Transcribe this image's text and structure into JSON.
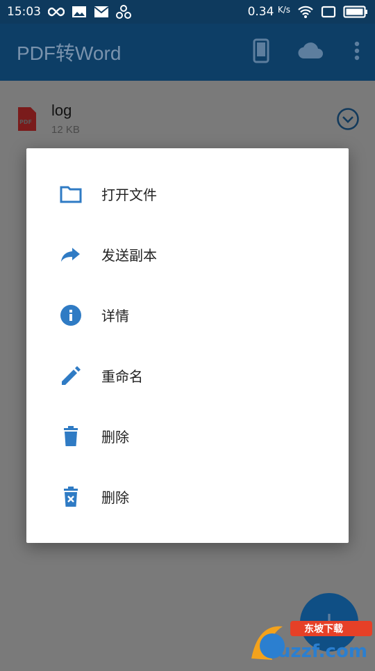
{
  "status_bar": {
    "time": "15:03",
    "speed": "0.34",
    "speed_unit": "K/s"
  },
  "app_bar": {
    "title": "PDF转Word"
  },
  "file": {
    "name": "log",
    "size": "12 KB",
    "badge": "PDF"
  },
  "fab": {
    "label": "+"
  },
  "menu": [
    {
      "label": "打开文件",
      "icon": "folder-icon"
    },
    {
      "label": "发送副本",
      "icon": "share-icon"
    },
    {
      "label": "详情",
      "icon": "info-icon"
    },
    {
      "label": "重命名",
      "icon": "edit-icon"
    },
    {
      "label": "删除",
      "icon": "delete-icon"
    },
    {
      "label": "删除",
      "icon": "delete-forever-icon"
    }
  ],
  "watermark": {
    "text": "uzzf.com",
    "tag": "东坡下载"
  },
  "colors": {
    "accent": "#2f7bc4",
    "appbar": "#0d3e66",
    "statusbar": "#0e3a5e",
    "pdf_red": "#d32f2f"
  }
}
